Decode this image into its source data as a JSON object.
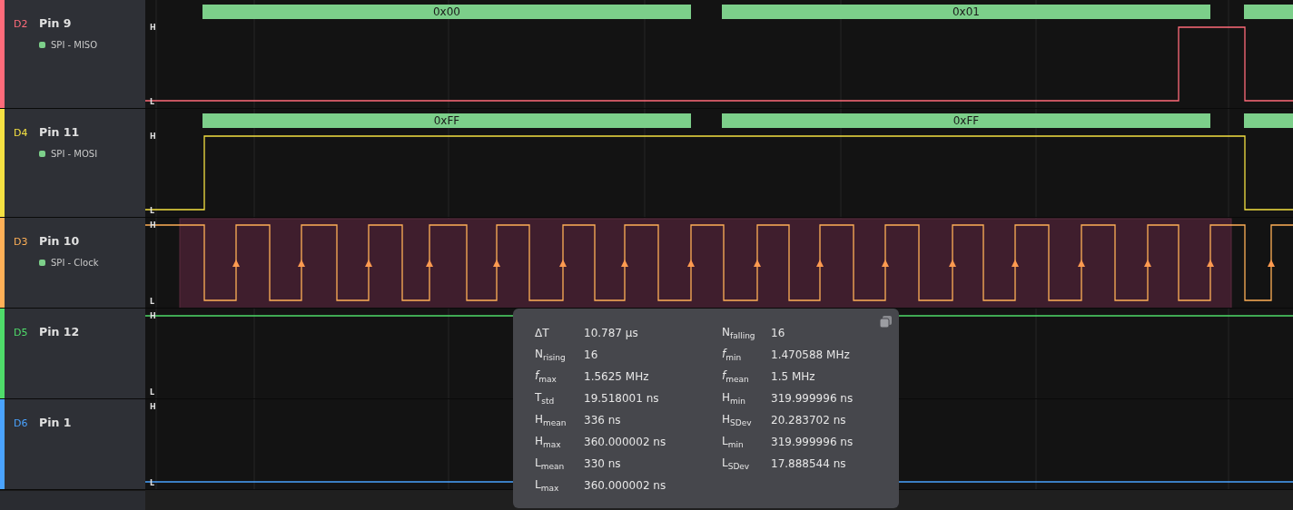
{
  "channels": [
    {
      "id": "D2",
      "name": "Pin 9",
      "color": "#ff6b7a",
      "decoder": "SPI - MISO",
      "frames": [
        "0x00",
        "0x01"
      ],
      "high_label": "H",
      "low_label": "L"
    },
    {
      "id": "D4",
      "name": "Pin 11",
      "color": "#f5e142",
      "decoder": "SPI - MOSI",
      "frames": [
        "0xFF",
        "0xFF"
      ],
      "high_label": "H",
      "low_label": "L"
    },
    {
      "id": "D3",
      "name": "Pin 10",
      "color": "#ffb057",
      "decoder": "SPI - Clock",
      "high_label": "H",
      "low_label": "L"
    },
    {
      "id": "D5",
      "name": "Pin 12",
      "color": "#4fdc6a",
      "high_label": "H",
      "low_label": "L"
    },
    {
      "id": "D6",
      "name": "Pin 1",
      "color": "#4aa3ff",
      "high_label": "H",
      "low_label": "L"
    }
  ],
  "measurement": {
    "left": [
      {
        "label": "ΔT",
        "value": "10.787 µs"
      },
      {
        "label": "N$_{rising}$",
        "value": "16"
      },
      {
        "label": "*f*$_{max}$",
        "value": "1.5625 MHz"
      },
      {
        "label": "T$_{std}$",
        "value": "19.518001 ns"
      },
      {
        "label": "H$_{mean}$",
        "value": "336 ns"
      },
      {
        "label": "H$_{max}$",
        "value": "360.000002 ns"
      },
      {
        "label": "L$_{mean}$",
        "value": "330 ns"
      },
      {
        "label": "L$_{max}$",
        "value": "360.000002 ns"
      }
    ],
    "right": [
      {
        "label": "N$_{falling}$",
        "value": "16"
      },
      {
        "label": "*f*$_{min}$",
        "value": "1.470588 MHz"
      },
      {
        "label": "*f*$_{mean}$",
        "value": "1.5 MHz"
      },
      {
        "label": "H$_{min}$",
        "value": "319.999996 ns"
      },
      {
        "label": "H$_{SDev}$",
        "value": "20.283702 ns"
      },
      {
        "label": "L$_{min}$",
        "value": "319.999996 ns"
      },
      {
        "label": "L$_{SDev}$",
        "value": "17.888544 ns"
      }
    ]
  }
}
